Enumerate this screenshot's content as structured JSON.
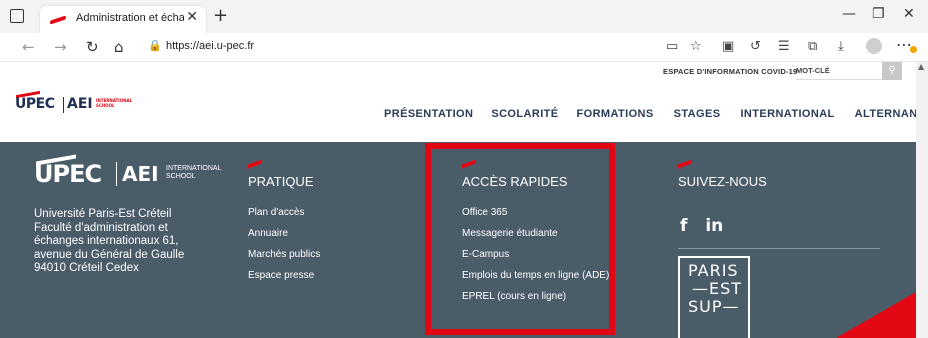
{
  "browser": {
    "tab_title": "Administration et échanges inte",
    "url": "https://aei.u-pec.fr"
  },
  "site": {
    "top_links": "ESPACE D'INFORMATION COVID-19",
    "search_placeholder": "MOT-CLÉ",
    "logo": {
      "upec": "UPEC",
      "aei": "AEI",
      "aei_sub": "INTERNATIONAL SCHOOL"
    },
    "nav": [
      "PRÉSENTATION",
      "SCOLARITÉ",
      "FORMATIONS",
      "STAGES",
      "INTERNATIONAL",
      "ALTERNANCE"
    ]
  },
  "footer": {
    "logo": {
      "upec": "UPEC",
      "aei": "AEI",
      "aei_sub": "INTERNATIONAL SCHOOL"
    },
    "address": "Université Paris-Est Créteil Faculté d'administration et échanges internationaux 61, avenue du Général de Gaulle 94010 Créteil Cedex",
    "pratique": {
      "title": "PRATIQUE",
      "links": [
        "Plan d'accès",
        "Annuaire",
        "Marchés publics",
        "Espace presse"
      ]
    },
    "acces": {
      "title": "ACCÈS RAPIDES",
      "links": [
        "Office 365",
        "Messagerie étudiante",
        "E-Campus",
        "Emplois du temps en ligne (ADE)",
        "EPREL (cours en ligne)"
      ]
    },
    "suivez": {
      "title": "SUIVEZ-NOUS",
      "facebook": "f",
      "linkedin": "in"
    },
    "paris_est_sup": [
      "PARIS",
      "—EST",
      "SUP—"
    ]
  },
  "colors": {
    "accent": "#e30613",
    "footer_bg": "#4b5c69",
    "nav_text": "#2a3b5a"
  }
}
